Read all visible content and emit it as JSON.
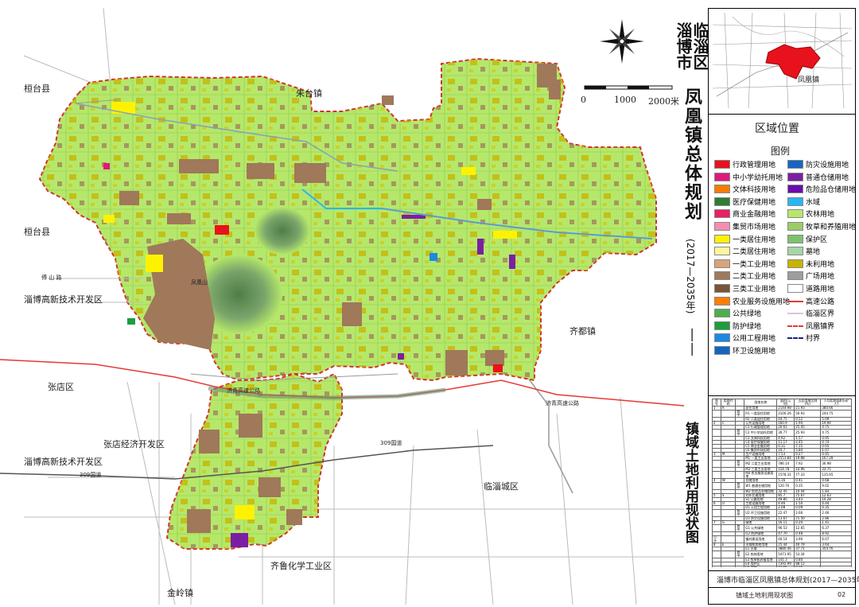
{
  "plan": {
    "district": "临淄区",
    "city": "淄博市",
    "title": "凤凰镇总体规划",
    "period": "(2017—2035年)",
    "dash": "——",
    "subtitle": "镇域土地利用现状图",
    "footer_title": "淄博市临淄区凤凰镇总体规划(2017—2035年)",
    "footer_sub": "镇域土地利用现状图",
    "sheet_no": "02"
  },
  "scale_bar": {
    "labels": [
      "0",
      "1000",
      "2000米"
    ]
  },
  "location_map": {
    "title": "区域位置",
    "marker_label": "凤凰镇",
    "colors": {
      "town": "#e8121c",
      "district": "#f5f5f5"
    }
  },
  "legend": {
    "title": "图例",
    "items": [
      {
        "label": "行政管理用地",
        "color": "#e8121c",
        "kind": "fill"
      },
      {
        "label": "防灾设施用地",
        "color": "#1565c0",
        "kind": "fill"
      },
      {
        "label": "中小学幼托用地",
        "color": "#e0187a",
        "kind": "fill"
      },
      {
        "label": "普通仓储用地",
        "color": "#7b1fa2",
        "kind": "fill"
      },
      {
        "label": "文体科技用地",
        "color": "#f57c00",
        "kind": "fill"
      },
      {
        "label": "危险品仓储用地",
        "color": "#6a0dad",
        "kind": "fill"
      },
      {
        "label": "医疗保健用地",
        "color": "#2e7d32",
        "kind": "fill"
      },
      {
        "label": "水域",
        "color": "#29b6f6",
        "kind": "fill"
      },
      {
        "label": "商业金融用地",
        "color": "#e91e63",
        "kind": "fill"
      },
      {
        "label": "农林用地",
        "color": "#b5e86a",
        "kind": "fill"
      },
      {
        "label": "集贸市场用地",
        "color": "#f48fb1",
        "kind": "fill"
      },
      {
        "label": "牧草和养殖用地",
        "color": "#9ccc65",
        "kind": "fill"
      },
      {
        "label": "一类居住用地",
        "color": "#fff200",
        "kind": "fill"
      },
      {
        "label": "保护区",
        "color": "#7cc36b",
        "kind": "fill"
      },
      {
        "label": "二类居住用地",
        "color": "#fff59d",
        "kind": "fill"
      },
      {
        "label": "墓地",
        "color": "#a5d6a7",
        "kind": "fill"
      },
      {
        "label": "一类工业用地",
        "color": "#d7a57a",
        "kind": "fill"
      },
      {
        "label": "未利用地",
        "color": "#c8b400",
        "kind": "fill"
      },
      {
        "label": "二类工业用地",
        "color": "#a0785a",
        "kind": "fill"
      },
      {
        "label": "广场用地",
        "color": "#9e9e9e",
        "kind": "fill"
      },
      {
        "label": "三类工业用地",
        "color": "#7a5538",
        "kind": "fill"
      },
      {
        "label": "道路用地",
        "color": "#ffffff",
        "kind": "fill"
      },
      {
        "label": "农业服务设施用地",
        "color": "#ff7f00",
        "kind": "fill"
      },
      {
        "label": "高速公路",
        "color": "#e53935",
        "kind": "line"
      },
      {
        "label": "公共绿地",
        "color": "#4caf50",
        "kind": "fill"
      },
      {
        "label": "临淄区界",
        "color": "#e1bee7",
        "kind": "line"
      },
      {
        "label": "防护绿地",
        "color": "#1b9e3e",
        "kind": "fill"
      },
      {
        "label": "凤凰镇界",
        "color": "#e53935",
        "kind": "dash"
      },
      {
        "label": "公用工程用地",
        "color": "#1e88e5",
        "kind": "fill"
      },
      {
        "label": "村界",
        "color": "#1a237e",
        "kind": "dash"
      },
      {
        "label": "环卫设施用地",
        "color": "#1565c0",
        "kind": "fill"
      }
    ]
  },
  "map_labels": [
    {
      "text": "桓台县",
      "cls": "map-lbl"
    },
    {
      "text": "朱台镇",
      "cls": "map-lbl"
    },
    {
      "text": "桓台县",
      "cls": "map-lbl"
    },
    {
      "text": "淄博高新技术开发区",
      "cls": "map-lbl"
    },
    {
      "text": "齐都镇",
      "cls": "map-lbl"
    },
    {
      "text": "张店区",
      "cls": "map-lbl"
    },
    {
      "text": "张店经济开发区",
      "cls": "map-lbl"
    },
    {
      "text": "淄博高新技术开发区",
      "cls": "map-lbl"
    },
    {
      "text": "临淄城区",
      "cls": "map-lbl"
    },
    {
      "text": "齐鲁化学工业区",
      "cls": "map-lbl"
    },
    {
      "text": "金岭镇",
      "cls": "map-lbl"
    },
    {
      "text": "济青高速公路",
      "cls": "map-lbl"
    },
    {
      "text": "309国道",
      "cls": "map-lbl"
    },
    {
      "text": "309国道",
      "cls": "map-lbl"
    },
    {
      "text": "傅 山 路",
      "cls": "map-lbl"
    },
    {
      "text": "济青高速公路",
      "cls": "map-lbl"
    },
    {
      "text": "凤凰山",
      "cls": "map-lbl"
    }
  ],
  "stats_table": {
    "headers": [
      "序号",
      "用地代码",
      "",
      "用地名称",
      "面积(公顷)",
      "占总用地比例(%)",
      "人均用地面积(㎡/人)"
    ],
    "rows": [
      [
        "1",
        "R",
        "",
        "居住用地",
        "2144.98",
        "21.93",
        "380.66"
      ],
      [
        "",
        "",
        "其中",
        "R1 一类居住用地",
        "2100.26",
        "50.93",
        "244.75"
      ],
      [
        "",
        "",
        "",
        "R2 二类居住用地",
        "44.75",
        "0.52",
        "5.09"
      ],
      [
        "2",
        "C",
        "",
        "公共设施用地",
        "160.9",
        "1.94",
        "19.94"
      ],
      [
        "",
        "",
        "",
        "C1 行政管理用地",
        "20.61",
        "25.45",
        "4.75"
      ],
      [
        "",
        "",
        "其中",
        "C2 中小学幼托用地",
        "30.77",
        "25.93",
        "4.75"
      ],
      [
        "",
        "",
        "",
        "C3 文体科技用地",
        "4.92",
        "1.57",
        "0.95"
      ],
      [
        "",
        "",
        "",
        "C4 医疗保健用地",
        "11.17",
        "2.45",
        "0.74"
      ],
      [
        "",
        "",
        "",
        "C5 商业金融用地",
        "0.31",
        "7.15",
        "0.05"
      ],
      [
        "",
        "",
        "",
        "C6 集贸市场用地",
        "10.7",
        "5.84",
        "1.07"
      ],
      [
        "3",
        "M",
        "",
        "生产设施用地",
        "7.53",
        "0.27",
        "0.45"
      ],
      [
        "",
        "",
        "",
        "M1 一类工业用地",
        "2551.84",
        "19.88",
        "167.28"
      ],
      [
        "",
        "",
        "其中",
        "M2 二类工业用地",
        "786.14",
        "7.92",
        "36.98"
      ],
      [
        "",
        "",
        "",
        "M3 三类工业用地",
        "154.78",
        "14.96",
        "33.75"
      ],
      [
        "",
        "",
        "",
        "M4 农业服务设施用地",
        "1578.31",
        "77.33",
        "135.65"
      ],
      [
        "4",
        "W",
        "",
        "仓储用地",
        "5.16",
        "0.41",
        "0.68"
      ],
      [
        "",
        "",
        "其中",
        "W1 普通仓储用地",
        "120.70",
        "0.35",
        "9.02"
      ],
      [
        "",
        "",
        "",
        "W2 危险品仓储用地",
        "32.45",
        "10.44",
        "1.83"
      ],
      [
        "5",
        "S",
        "",
        "对外交通用地",
        "85.7",
        "75.67",
        "12.63"
      ],
      [
        "",
        "",
        "",
        "S1 公路用地",
        "49.85",
        "3.43",
        "10.28"
      ],
      [
        "6",
        "U",
        "",
        "工程设施用地",
        "4.46",
        "1.50",
        "0.44"
      ],
      [
        "",
        "",
        "",
        "U1 公用工程用地",
        "2.08",
        "0.09",
        "0.35"
      ],
      [
        "",
        "",
        "其中",
        "U2 环卫设施用地",
        "22.47",
        "2.66",
        "2.46"
      ],
      [
        "",
        "",
        "",
        "U3 防灾设施用地",
        "13.67",
        "71.50",
        "2.86"
      ],
      [
        "7",
        "G",
        "",
        "绿地",
        "16.11",
        "0.20",
        "1.41"
      ],
      [
        "",
        "",
        "其中",
        "G1 公共绿地",
        "96.53",
        "12.65",
        "6.37"
      ],
      [
        "",
        "",
        "",
        "G2 防护绿地",
        "47.70",
        "0.48",
        "8.92"
      ],
      [
        "小计",
        "",
        "",
        "镇村建设用地",
        "40.14",
        "3.90",
        "6.07"
      ],
      [
        "8",
        "E",
        "",
        "水域和其他用地",
        "25.44",
        "40.79",
        "3.64"
      ],
      [
        "",
        "",
        "",
        "E1 水域",
        "3880.46",
        "37.71",
        "354.76"
      ],
      [
        "",
        "",
        "其中",
        "E2 农林用地",
        "5471.95",
        "53.34",
        ""
      ],
      [
        "",
        "",
        "",
        "E3 牧草和养殖用地",
        "141.3",
        "0.80",
        ""
      ],
      [
        "",
        "",
        "",
        "E4 保护区",
        "7392.99",
        "88.12",
        ""
      ],
      [
        "",
        "",
        "",
        "E5 墓地",
        "77.66",
        "0.16",
        ""
      ],
      [
        "",
        "",
        "",
        "E6 未利用地",
        "16.5",
        "0.56",
        ""
      ],
      [
        "合计",
        "",
        "",
        "总用地",
        "19.4",
        "0.56",
        ""
      ]
    ]
  }
}
